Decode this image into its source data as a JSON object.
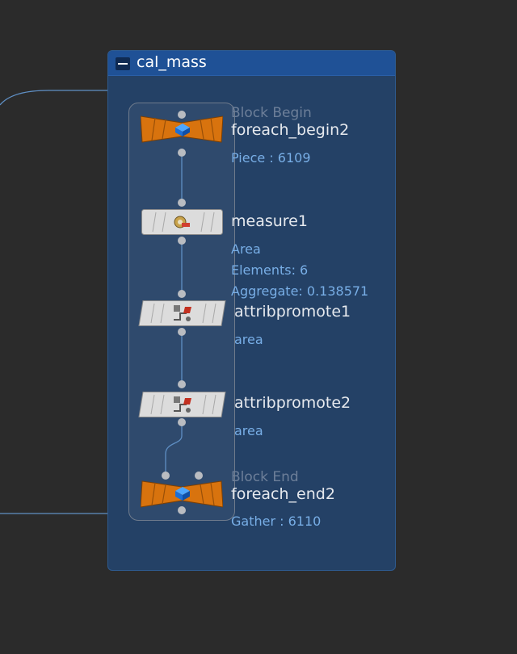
{
  "network_box": {
    "title": "cal_mass"
  },
  "nodes": [
    {
      "id": "foreach_begin2",
      "caption": "Block Begin",
      "name": "foreach_begin2",
      "info": [
        "Piece : 6109"
      ],
      "color": "#d8730e",
      "icon": "foreach-block-icon"
    },
    {
      "id": "measure1",
      "caption": "",
      "name": "measure1",
      "info": [
        "Area",
        "Elements: 6",
        "Aggregate: 0.138571"
      ],
      "color": "#dcdcdc",
      "icon": "tape-measure-icon"
    },
    {
      "id": "attribpromote1",
      "caption": "",
      "name": "attribpromote1",
      "info": [
        "area"
      ],
      "color": "#dcdcdc",
      "icon": "attrib-promote-icon"
    },
    {
      "id": "attribpromote2",
      "caption": "",
      "name": "attribpromote2",
      "info": [
        "area"
      ],
      "color": "#dcdcdc",
      "icon": "attrib-promote-icon"
    },
    {
      "id": "foreach_end2",
      "caption": "Block End",
      "name": "foreach_end2",
      "info": [
        "Gather : 6110"
      ],
      "color": "#d8730e",
      "icon": "foreach-block-icon"
    }
  ],
  "colors": {
    "background": "#2b2b2b",
    "network_box_fill": "#244166",
    "network_box_header": "#1f5196",
    "wire": "#5f8fc4",
    "foreach_node": "#d8730e",
    "default_node": "#dcdcdc",
    "info_text": "#78aee6"
  }
}
